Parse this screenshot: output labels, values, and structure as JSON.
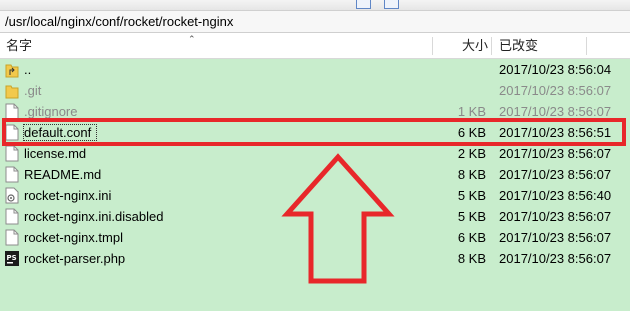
{
  "path": "/usr/local/nginx/conf/rocket/rocket-nginx",
  "columns": {
    "name": "名字",
    "size": "大小",
    "modified": "已改变"
  },
  "files": [
    {
      "name": "..",
      "size": "",
      "modified": "2017/10/23 8:56:04",
      "icon": "folder-up-icon",
      "dim": false
    },
    {
      "name": ".git",
      "size": "",
      "modified": "2017/10/23 8:56:07",
      "icon": "folder-icon",
      "dim": true
    },
    {
      "name": ".gitignore",
      "size": "1 KB",
      "modified": "2017/10/23 8:56:07",
      "icon": "file-icon",
      "dim": true
    },
    {
      "name": "default.conf",
      "size": "6 KB",
      "modified": "2017/10/23 8:56:51",
      "icon": "file-icon",
      "dim": false
    },
    {
      "name": "license.md",
      "size": "2 KB",
      "modified": "2017/10/23 8:56:07",
      "icon": "file-icon",
      "dim": false
    },
    {
      "name": "README.md",
      "size": "8 KB",
      "modified": "2017/10/23 8:56:07",
      "icon": "file-icon",
      "dim": false
    },
    {
      "name": "rocket-nginx.ini",
      "size": "5 KB",
      "modified": "2017/10/23 8:56:40",
      "icon": "ini-file-icon",
      "dim": false
    },
    {
      "name": "rocket-nginx.ini.disabled",
      "size": "5 KB",
      "modified": "2017/10/23 8:56:07",
      "icon": "file-icon",
      "dim": false
    },
    {
      "name": "rocket-nginx.tmpl",
      "size": "6 KB",
      "modified": "2017/10/23 8:56:07",
      "icon": "file-icon",
      "dim": false
    },
    {
      "name": "rocket-parser.php",
      "size": "8 KB",
      "modified": "2017/10/23 8:56:07",
      "icon": "phpstorm-file-icon",
      "dim": false
    }
  ],
  "colors": {
    "list_bg": "#c8edcc",
    "annotation": "#e8272a"
  }
}
